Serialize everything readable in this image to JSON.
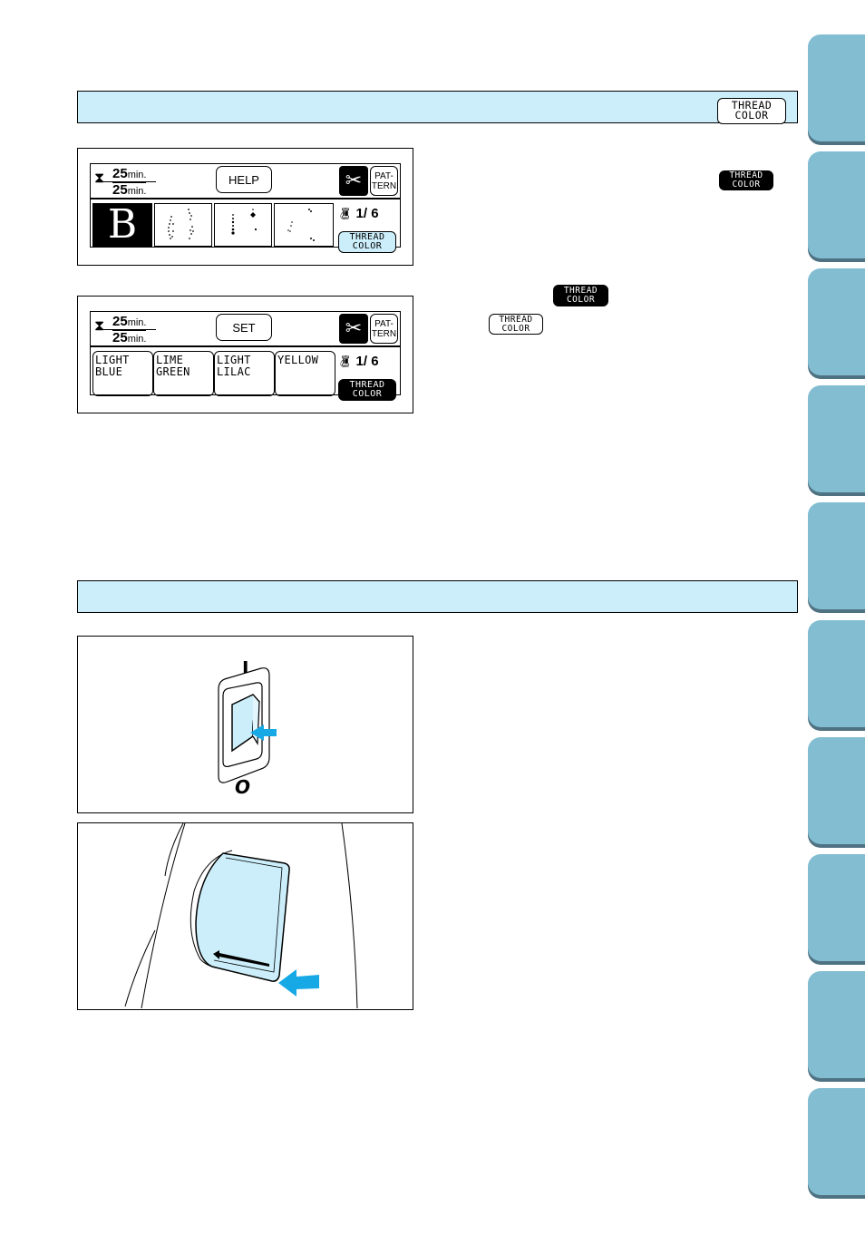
{
  "section1": {
    "header_button": {
      "line1": "THREAD",
      "line2": "COLOR",
      "icon": "thread-color-button-icon"
    }
  },
  "screen1": {
    "timer": {
      "icon": "hourglass-icon",
      "remaining": "25",
      "total": "25",
      "unit": "min."
    },
    "center_button": "HELP",
    "scissors_icon": "scissors-icon",
    "pattern_button": {
      "line1": "PAT-",
      "line2": "TERN"
    },
    "selected_letter": "B",
    "stitch_previews": [
      "stitch-pattern-1",
      "stitch-pattern-2",
      "stitch-pattern-3"
    ],
    "counter": {
      "icon": "spool-icon",
      "value": "1/ 6"
    },
    "thread_color_button": {
      "line1": "THREAD",
      "line2": "COLOR",
      "state": "highlighted"
    }
  },
  "screen2": {
    "timer": {
      "icon": "hourglass-icon",
      "remaining": "25",
      "total": "25",
      "unit": "min."
    },
    "center_button": "SET",
    "scissors_icon": "scissors-icon",
    "pattern_button": {
      "line1": "PAT-",
      "line2": "TERN"
    },
    "colors": [
      {
        "line1": "LIGHT",
        "line2": "BLUE"
      },
      {
        "line1": "LIME",
        "line2": "GREEN"
      },
      {
        "line1": "LIGHT",
        "line2": "LILAC"
      },
      {
        "line1": "YELLOW",
        "line2": ""
      }
    ],
    "counter": {
      "icon": "spool-icon",
      "value": "1/ 6"
    },
    "thread_color_button": {
      "line1": "THREAD",
      "line2": "COLOR",
      "state": "pressed"
    }
  },
  "inline_icons": [
    {
      "line1": "THREAD",
      "line2": "COLOR",
      "style": "dark"
    },
    {
      "line1": "THREAD",
      "line2": "COLOR",
      "style": "dark"
    },
    {
      "line1": "THREAD",
      "line2": "COLOR",
      "style": "light"
    }
  ],
  "section2": {
    "switch_labels": {
      "on": "I",
      "off": "O"
    }
  },
  "colors": {
    "section_bar": "#cbeefa",
    "tab": "#82bdd2",
    "tab_shadow": "#4f7282",
    "arrow": "#17a9e6",
    "highlight": "#cbeefa"
  },
  "side_tabs": 10
}
